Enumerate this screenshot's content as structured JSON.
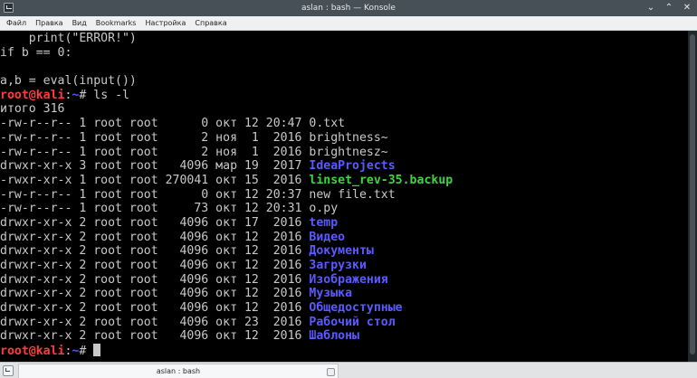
{
  "window": {
    "title": "aslan : bash — Konsole",
    "app_icon": "terminal-icon",
    "minimize_glyph": "⌄",
    "maximize_glyph": "⌃",
    "close_glyph": "✕"
  },
  "menu": {
    "items": [
      "Файл",
      "Правка",
      "Вид",
      "Bookmarks",
      "Настройка",
      "Справка"
    ]
  },
  "terminal": {
    "lines": [
      {
        "kind": "text",
        "text": "    print(\"ERROR!\")"
      },
      {
        "kind": "text",
        "text": "if b == 0:"
      },
      {
        "kind": "text",
        "text": ""
      },
      {
        "kind": "text",
        "text": "a,b = eval(input())"
      },
      {
        "kind": "prompt",
        "user": "root@kali",
        "sep": ":",
        "path": "~",
        "symbol": "#",
        "command": " ls -l"
      },
      {
        "kind": "text",
        "text": "итого 316"
      },
      {
        "kind": "ls",
        "text": "-rw-r--r-- 1 root root      0 окт 12 20:47 ",
        "name": "0.txt",
        "type": "file"
      },
      {
        "kind": "ls",
        "text": "-rw-r--r-- 1 root root      2 ноя  1  2016 ",
        "name": "brightness~",
        "type": "file"
      },
      {
        "kind": "ls",
        "text": "-rw-r--r-- 1 root root      2 ноя  1  2016 ",
        "name": "brightnesz~",
        "type": "file"
      },
      {
        "kind": "ls",
        "text": "drwxr-xr-x 3 root root   4096 мар 19  2017 ",
        "name": "IdeaProjects",
        "type": "dir"
      },
      {
        "kind": "ls",
        "text": "-rwxr-xr-x 1 root root 270041 окт 15  2016 ",
        "name": "linset_rev-35.backup",
        "type": "exe"
      },
      {
        "kind": "ls",
        "text": "-rw-r--r-- 1 root root      0 окт 12 20:37 ",
        "name": "new file.txt",
        "type": "file"
      },
      {
        "kind": "ls",
        "text": "-rw-r--r-- 1 root root     73 окт 12 20:31 ",
        "name": "o.py",
        "type": "file"
      },
      {
        "kind": "ls",
        "text": "drwxr-xr-x 2 root root   4096 окт 17  2016 ",
        "name": "temp",
        "type": "dir"
      },
      {
        "kind": "ls",
        "text": "drwxr-xr-x 2 root root   4096 окт 12  2016 ",
        "name": "Видео",
        "type": "dir"
      },
      {
        "kind": "ls",
        "text": "drwxr-xr-x 2 root root   4096 окт 12  2016 ",
        "name": "Документы",
        "type": "dir"
      },
      {
        "kind": "ls",
        "text": "drwxr-xr-x 2 root root   4096 окт 12  2016 ",
        "name": "Загрузки",
        "type": "dir"
      },
      {
        "kind": "ls",
        "text": "drwxr-xr-x 2 root root   4096 окт 12  2016 ",
        "name": "Изображения",
        "type": "dir"
      },
      {
        "kind": "ls",
        "text": "drwxr-xr-x 2 root root   4096 окт 12  2016 ",
        "name": "Музыка",
        "type": "dir"
      },
      {
        "kind": "ls",
        "text": "drwxr-xr-x 2 root root   4096 окт 12  2016 ",
        "name": "Общедоступные",
        "type": "dir"
      },
      {
        "kind": "ls",
        "text": "drwxr-xr-x 2 root root   4096 окт 23  2016 ",
        "name": "Рабочий стол",
        "type": "dir"
      },
      {
        "kind": "ls",
        "text": "drwxr-xr-x 2 root root   4096 окт 12  2016 ",
        "name": "Шаблоны",
        "type": "dir"
      },
      {
        "kind": "prompt",
        "user": "root@kali",
        "sep": ":",
        "path": "~",
        "symbol": "#",
        "command": " ",
        "cursor": true
      }
    ]
  },
  "tabbar": {
    "new_tab_icon": "new-tab-icon",
    "tab_label": "aslan : bash",
    "close_icon": "close-tab-icon"
  },
  "colors": {
    "prompt_user": "#ff3b3b",
    "prompt_path": "#5555ff",
    "directory": "#5a5aff",
    "executable": "#3ad83a",
    "foreground": "#c8c8c8",
    "background": "#000000"
  }
}
